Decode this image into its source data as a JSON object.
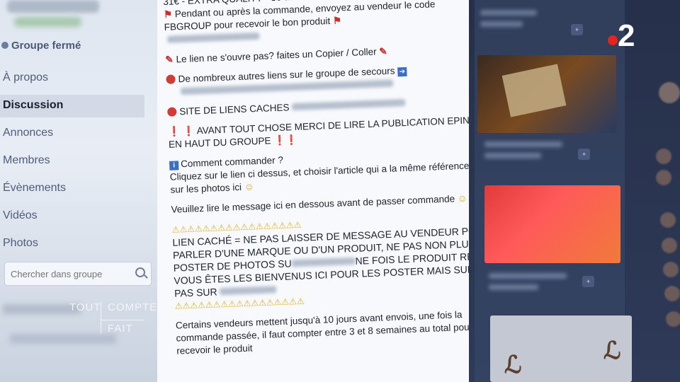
{
  "sidebar": {
    "group_status": "Groupe fermé",
    "nav": [
      {
        "label": "À propos"
      },
      {
        "label": "Discussion"
      },
      {
        "label": "Annonces"
      },
      {
        "label": "Membres"
      },
      {
        "label": "Évènements"
      },
      {
        "label": "Vidéos"
      },
      {
        "label": "Photos"
      }
    ],
    "search_placeholder": "Chercher dans groupe"
  },
  "post": {
    "lines": [
      "31€ - EXTRA QUALITY - 36 au 45 -",
      "Pendant ou après la commande, envoyez au vendeur le code",
      "FBGROUP pour recevoir le bon produit",
      "Le lien ne s'ouvre pas? faites un Copier / Coller",
      "De nombreux autres liens sur le groupe de secours",
      "SITE DE LIENS CACHES",
      "AVANT TOUT CHOSE MERCI DE LIRE LA PUBLICATION EPINGLE",
      "EN HAUT DU GROUPE",
      "Comment commander ?",
      "Cliquez sur le lien ci dessus, et choisir l'article qui a la même référence que",
      "sur les photos ici",
      "Veuillez lire le message ici en dessous avant de passer commande",
      "LIEN CACHÉ = NE PAS LAISSER DE MESSAGE AU VENDEUR POUR LUI",
      "PARLER D'UNE MARQUE OU D'UN PRODUIT, NE PAS NON PLUS",
      "POSTER DE PHOTOS SU",
      "NE FOIS LE PRODUIT REÇU,",
      "VOUS ÊTES LES BIENVENUS ICI POUR LES POSTER MAIS SURTOUT",
      "PAS SUR",
      "Certains vendeurs mettent jusqu'à 10 jours avant envois, une fois la",
      "commande passée, il faut compter entre 3 et 8 semaines au total pour",
      "recevoir le produit"
    ],
    "stars": "★★★★★",
    "warnings": "⚠⚠⚠⚠⚠⚠⚠⚠⚠⚠⚠⚠⚠⚠⚠⚠⚠"
  },
  "watermark": {
    "word1": "TOUT",
    "word2": "COMPTE",
    "word3": "FAIT"
  },
  "channel_logo": {
    "number": "2"
  },
  "colors": {
    "logo_dot": "#e3261d",
    "alert_red": "#d33b36",
    "info_blue": "#3b6fc6"
  }
}
